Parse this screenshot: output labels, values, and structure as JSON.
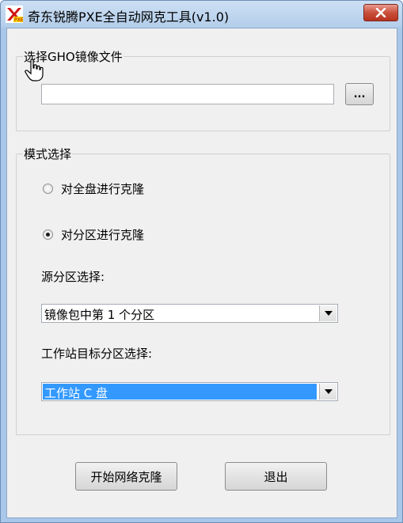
{
  "window": {
    "title": "奇东锐腾PXE全自动网克工具(v1.0)",
    "icon": "pxe-app-icon",
    "close_icon": "close-icon"
  },
  "gho_group": {
    "legend": "选择GHO镜像文件",
    "path_value": "",
    "browse_label": "..."
  },
  "mode_group": {
    "legend": "模式选择",
    "radio_full_disk": {
      "label": "对全盘进行克隆",
      "checked": false
    },
    "radio_partition": {
      "label": "对分区进行克隆",
      "checked": true
    },
    "source_label": "源分区选择:",
    "source_select": {
      "value": "镜像包中第 1 个分区"
    },
    "target_label": "工作站目标分区选择:",
    "target_select": {
      "value": "工作站 C 盘"
    }
  },
  "buttons": {
    "start": "开始网络克隆",
    "exit": "退出"
  },
  "colors": {
    "selection": "#3399ff",
    "close_button": "#c9503c",
    "frame": "#a9c7e8"
  }
}
